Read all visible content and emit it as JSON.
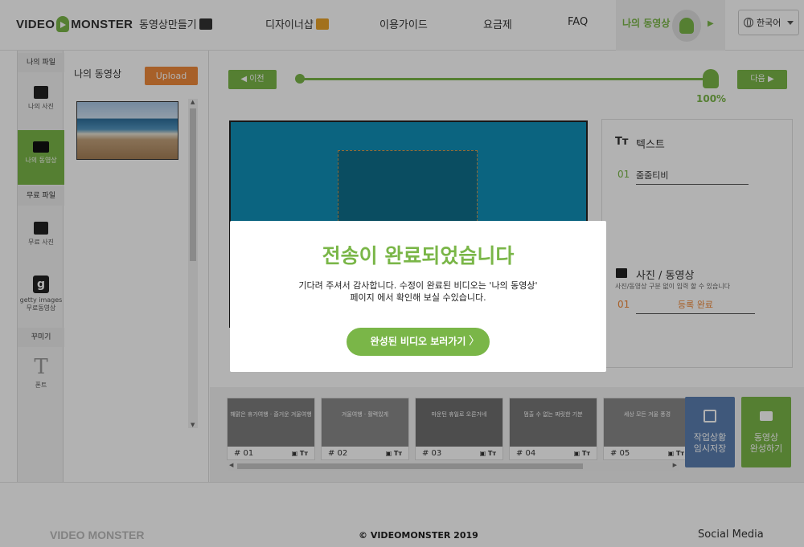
{
  "header": {
    "logo_left": "VIDEO",
    "logo_right": "MONSTER",
    "nav": [
      "동영상만들기",
      "디자이너샵",
      "이용가이드",
      "요금제",
      "FAQ"
    ],
    "my_video": "나의 동영상",
    "language": "한국어"
  },
  "rail": {
    "section_my": "나의 파일",
    "my_photo": "나의 사진",
    "my_video": "나의 동영상",
    "section_free": "무료 파일",
    "free_photo": "무료 사진",
    "getty_line1": "getty images",
    "getty_line2": "무료동영상",
    "section_deco": "꾸미기",
    "font": "폰트",
    "getty_glyph": "g",
    "font_glyph": "T"
  },
  "panel": {
    "title": "나의 동영상",
    "upload_label": "Upload"
  },
  "editor": {
    "prev_label": "◀ 이전",
    "next_label": "다음 ▶",
    "progress_text": "100%",
    "progress": 1.0,
    "text_section": "텍스트",
    "text_icon": "Tт",
    "text_num": "01",
    "text_value": "줌줌티비",
    "media_section": "사진 / 동영상",
    "media_note": "사진/동영상 구분 없이 입력 할 수 있습니다",
    "media_num": "01",
    "media_value": "등록 완료"
  },
  "timeline": {
    "clips": [
      {
        "label": "# 01",
        "caption": "해맑은 휴가여행 · 즐거운 겨울여행"
      },
      {
        "label": "# 02",
        "caption": "겨울여행 · 활력있게"
      },
      {
        "label": "# 03",
        "caption": "마운틴 휴일로 오른거네"
      },
      {
        "label": "# 04",
        "caption": "멈출 수 없는 짜릿한 기분"
      },
      {
        "label": "# 05",
        "caption": "세상 모든 겨울 풍경"
      }
    ],
    "clip_icon": "▣ Tт",
    "save_line1": "작업상황",
    "save_line2": "임시저장",
    "done_line1": "동영상",
    "done_line2": "완성하기"
  },
  "footer": {
    "logo": "VIDEO MONSTER",
    "copyright": "© VIDEOMONSTER 2019",
    "social": "Social Media"
  },
  "modal": {
    "title": "전송이 완료되었습니다",
    "message_line1": "기다려 주셔서 감사합니다. 수정이 완료된 비디오는 '나의 동영상'",
    "message_line2": "페이지 에서 확인해 보실 수있습니다.",
    "button_label": "완성된 비디오 보러가기",
    "button_chevron": "〉"
  },
  "colors": {
    "accent": "#7ab648",
    "upload": "#f08a3b",
    "canvas": "#1190b8",
    "save_button": "#5b7fb0",
    "done_button": "#7ab648"
  }
}
